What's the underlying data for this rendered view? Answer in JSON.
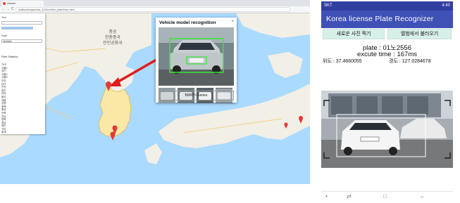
{
  "browser": {
    "tab_title": "Viewer",
    "nav_back": "←",
    "nav_forward": "→",
    "nav_reload": "C",
    "url": "localhost/maps/view_2015/vehicle_plate/index.html"
  },
  "map": {
    "labels": [
      "중공",
      "한중중국",
      "인민공화국"
    ],
    "markers": 5
  },
  "sidepanel": {
    "label1": "Tool",
    "label2": "Data",
    "select_value": "Vehicles",
    "list_title": "Plate Statistics",
    "list_items": [
      "TKS",
      "서울1",
      "경기",
      "서울2",
      "서울3",
      "부산",
      "대구",
      "인천",
      "광주",
      "대전",
      "울산",
      "세종",
      "강원",
      "충북",
      "충남",
      "전북",
      "전남",
      "경북",
      "경남",
      "제주",
      "기타",
      "통계"
    ]
  },
  "popup": {
    "title": "Vehicle model recognition",
    "close": "×",
    "model": "BMW 5 Series"
  },
  "phone": {
    "status_left": "SKT",
    "status_right": "4:40",
    "app_title": "Korea license Plate Recognizer",
    "btn_new_photo": "새로운 사진 찍기",
    "btn_load_album": "앨범에서 불러오기",
    "plate_text": "plate : 01노2556",
    "exec_text": "excute time : 167ms",
    "lat_text": "위도 : 37.4660055",
    "lng_text": "경도 : 127.0284678",
    "nav_dot": "•",
    "nav_recent": "⇄",
    "nav_home": "□",
    "nav_back": "←"
  },
  "colors": {
    "appbar": "#3f51b5",
    "statusbar": "#303f9f",
    "button_bg": "#d8f0ea",
    "sea": "#aadaff",
    "land": "#f2efe6",
    "korea": "#fbe8a6",
    "marker": "#e53935",
    "arrow": "#e21b1b"
  }
}
